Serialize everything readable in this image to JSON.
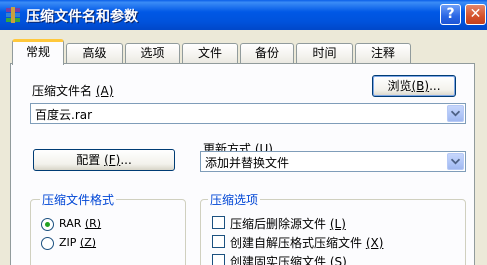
{
  "window": {
    "title": "压缩文件名和参数",
    "help_symbol": "?",
    "close_symbol": "✕"
  },
  "tabs": [
    {
      "label": "常规",
      "active": true
    },
    {
      "label": "高级",
      "active": false
    },
    {
      "label": "选项",
      "active": false
    },
    {
      "label": "文件",
      "active": false
    },
    {
      "label": "备份",
      "active": false
    },
    {
      "label": "时间",
      "active": false
    },
    {
      "label": "注释",
      "active": false
    }
  ],
  "archive_name": {
    "label": "压缩文件名",
    "key": "(A)",
    "value": "百度云.rar",
    "browse_label": "浏览",
    "browse_key": "(B)",
    "browse_suffix": "..."
  },
  "update_mode": {
    "label": "更新方式",
    "key": "(U)",
    "value": "添加并替换文件"
  },
  "profile": {
    "label": "配置",
    "key": "(F)",
    "suffix": "..."
  },
  "format_group": {
    "title": "压缩文件格式",
    "options": [
      {
        "label": "RAR",
        "key": "(R)",
        "selected": true
      },
      {
        "label": "ZIP",
        "key": "(Z)",
        "selected": false
      }
    ]
  },
  "options_group": {
    "title": "压缩选项",
    "items": [
      {
        "label": "压缩后删除源文件",
        "key": "(L)",
        "checked": false
      },
      {
        "label": "创建自解压格式压缩文件",
        "key": "(X)",
        "checked": false
      },
      {
        "label": "创建固实压缩文件",
        "key": "(S)",
        "checked": false
      }
    ]
  },
  "colors": {
    "title_bar": "#0058E6",
    "dialog_bg": "#ECE9D8",
    "group_title": "#0046D5",
    "tab_highlight": "#FFC83C"
  }
}
